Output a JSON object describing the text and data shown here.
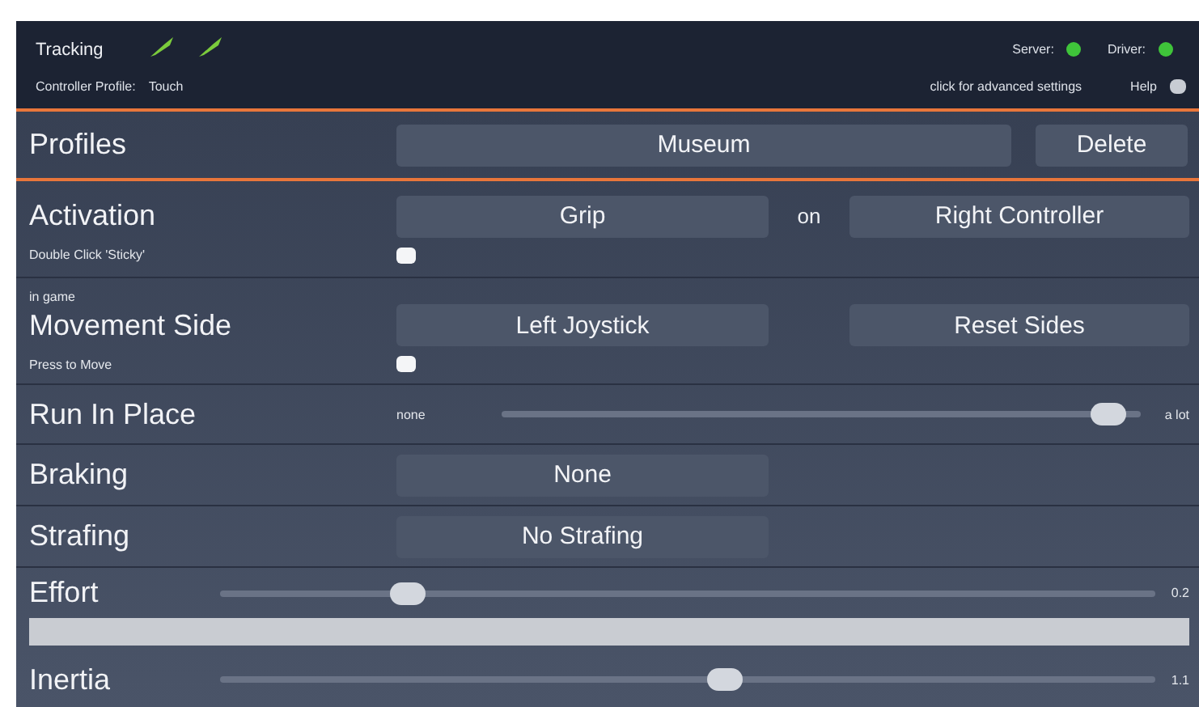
{
  "header": {
    "tracking": {
      "label": "Tracking",
      "devices": [
        {
          "active": true
        },
        {
          "active": true
        }
      ]
    },
    "status": [
      {
        "label": "Server:",
        "color": "#3fc43a"
      },
      {
        "label": "Driver:",
        "color": "#3fc43a"
      }
    ],
    "profile_label": "Controller Profile:",
    "profile_value": "Touch",
    "advanced_link": "click for advanced settings",
    "help": {
      "label": "Help",
      "on": false
    }
  },
  "profiles": {
    "label": "Profiles",
    "value": "Museum",
    "delete": "Delete"
  },
  "activation": {
    "label": "Activation",
    "button": "Grip",
    "on_label": "on",
    "controller": "Right Controller",
    "sticky": {
      "label": "Double Click 'Sticky'",
      "checked": false
    }
  },
  "movement": {
    "caption": "in game",
    "label": "Movement Side",
    "side": "Left Joystick",
    "reset": "Reset Sides",
    "press": {
      "label": "Press to Move",
      "checked": false
    }
  },
  "run_in_place": {
    "label": "Run In Place",
    "min_label": "none",
    "max_label": "a lot",
    "level": 0.95
  },
  "braking": {
    "label": "Braking",
    "value": "None"
  },
  "strafing": {
    "label": "Strafing",
    "value": "No Strafing"
  },
  "effort": {
    "label": "Effort",
    "level": 0.2,
    "reading": "0.2"
  },
  "inertia": {
    "label": "Inertia",
    "level": 0.54,
    "reading": "1.1"
  }
}
